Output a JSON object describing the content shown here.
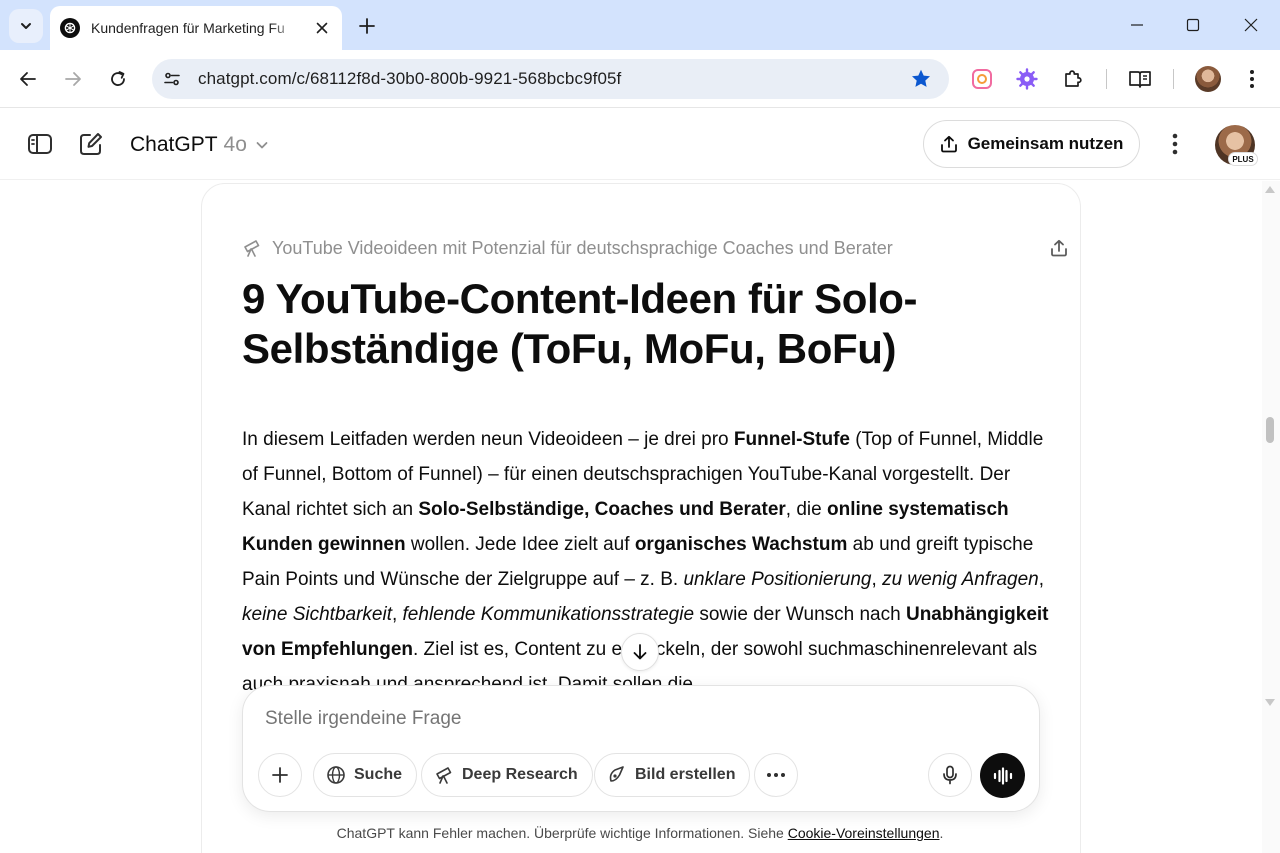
{
  "browser": {
    "tab": {
      "title": "Kundenfragen für Marketing Fu",
      "favicon": "chatgpt-logo-icon"
    },
    "address": {
      "url": "chatgpt.com/c/68112f8d-30b0-800b-9921-568bcbc9f05f"
    },
    "accent_color": "#d3e3fd"
  },
  "header": {
    "model_name": "ChatGPT",
    "model_version": "4o",
    "share_label": "Gemeinsam nutzen",
    "plan_badge": "PLUS"
  },
  "document": {
    "kicker": "YouTube Videoideen mit Potenzial für deutschsprachige Coaches und Berater",
    "title": "9 YouTube-Content-Ideen für Solo-Selbständige (ToFu, MoFu, BoFu)",
    "body": [
      {
        "t": "In diesem Leitfaden werden neun Videoideen – je drei pro ",
        "s": "n"
      },
      {
        "t": "Funnel-Stufe",
        "s": "b"
      },
      {
        "t": " (Top of Funnel, Middle of Funnel, Bottom of Funnel) – für einen deutschsprachigen YouTube-Kanal vorgestellt. Der Kanal richtet sich an ",
        "s": "n"
      },
      {
        "t": "Solo-Selbständige, Coaches und Berater",
        "s": "b"
      },
      {
        "t": ", die ",
        "s": "n"
      },
      {
        "t": "online systematisch Kunden gewinnen",
        "s": "b"
      },
      {
        "t": " wollen. Jede Idee zielt auf ",
        "s": "n"
      },
      {
        "t": "organisches Wachstum",
        "s": "b"
      },
      {
        "t": " ab und greift typische Pain Points und Wünsche der Zielgruppe auf – z. B. ",
        "s": "n"
      },
      {
        "t": "unklare Positionierung",
        "s": "i"
      },
      {
        "t": ", ",
        "s": "n"
      },
      {
        "t": "zu wenig Anfragen",
        "s": "i"
      },
      {
        "t": ", ",
        "s": "n"
      },
      {
        "t": "keine Sichtbarkeit",
        "s": "i"
      },
      {
        "t": ", ",
        "s": "n"
      },
      {
        "t": "fehlende Kommunikationsstrategie",
        "s": "i"
      },
      {
        "t": " sowie der Wunsch nach ",
        "s": "n"
      },
      {
        "t": "Unabhängigkeit von Empfehlungen",
        "s": "b"
      },
      {
        "t": ". Ziel ist es, Content zu entwickeln, der sowohl suchmaschinenrelevant als auch praxisnah und ansprechend ist. Damit sollen die",
        "s": "n"
      }
    ]
  },
  "composer": {
    "placeholder": "Stelle irgendeine Frage",
    "search_label": "Suche",
    "deep_research_label": "Deep Research",
    "image_label": "Bild erstellen"
  },
  "footer": {
    "disclaimer": "ChatGPT kann Fehler machen. Überprüfe wichtige Informationen. Siehe ",
    "link": "Cookie-Voreinstellungen",
    "end": "."
  }
}
